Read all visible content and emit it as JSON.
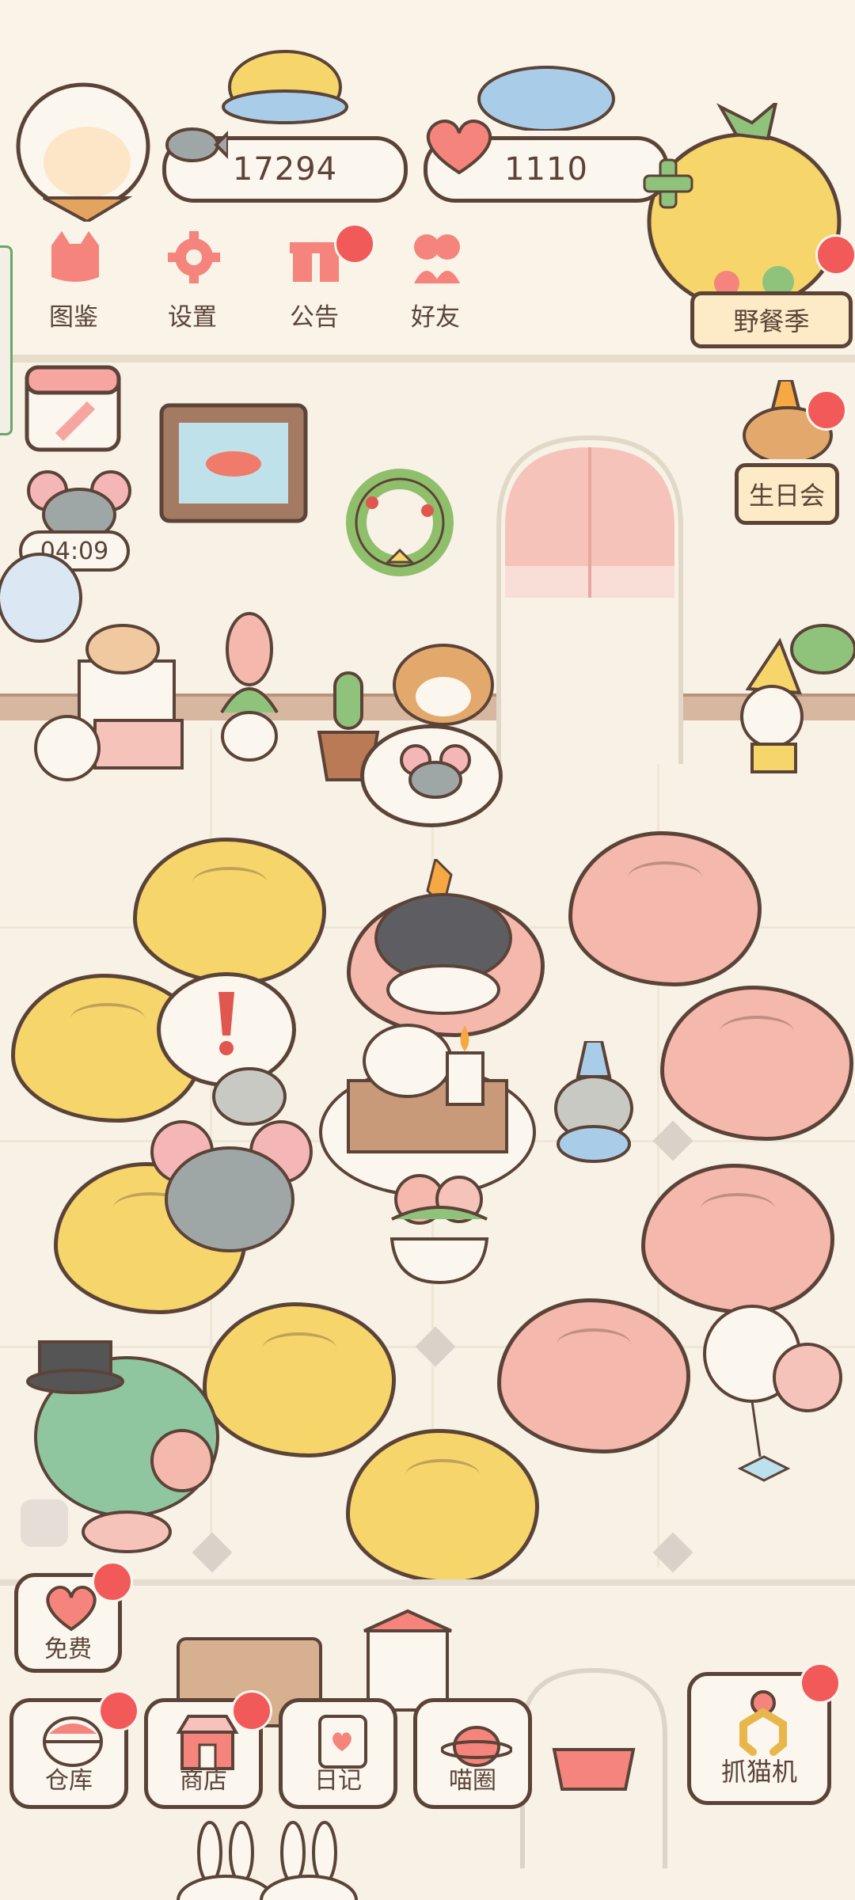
{
  "currency": {
    "fish_amount": "17294",
    "heart_amount": "1110"
  },
  "top_menu": [
    {
      "label": "图鉴",
      "icon": "cat-book-icon",
      "badge": false
    },
    {
      "label": "设置",
      "icon": "gear-icon",
      "badge": false
    },
    {
      "label": "公告",
      "icon": "gift-icon",
      "badge": true
    },
    {
      "label": "好友",
      "icon": "friends-icon",
      "badge": false
    }
  ],
  "events": {
    "picnic_label": "野餐季",
    "birthday_label": "生日会",
    "timer": "04:09"
  },
  "free_button": {
    "label": "免费"
  },
  "toolbar": [
    {
      "label": "仓库",
      "icon": "storage-icon",
      "badge": true
    },
    {
      "label": "商店",
      "icon": "shop-icon",
      "badge": true
    },
    {
      "label": "日记",
      "icon": "diary-icon",
      "badge": false
    },
    {
      "label": "喵圈",
      "icon": "cat-planet-icon",
      "badge": false
    }
  ],
  "claw_machine": {
    "label": "抓猫机",
    "badge": true
  },
  "colors": {
    "outline": "#5b4338",
    "badge": "#f25a5a",
    "yellow_cushion": "#f6d66b",
    "pink_cushion": "#f5b8ad",
    "floor": "#f7f1e6"
  }
}
